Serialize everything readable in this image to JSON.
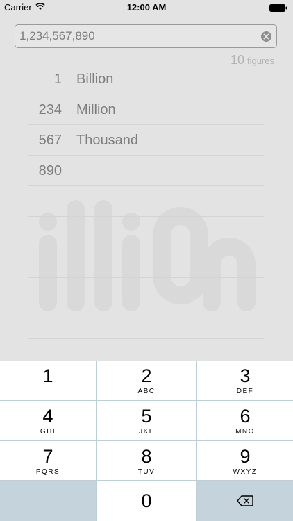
{
  "status_bar": {
    "carrier": "Carrier",
    "time": "12:00 AM"
  },
  "input": {
    "value": "1,234,567,890"
  },
  "figures": {
    "count": "10",
    "label": "figures"
  },
  "rows": [
    {
      "number": "1",
      "unit": "Billion"
    },
    {
      "number": "234",
      "unit": "Million"
    },
    {
      "number": "567",
      "unit": "Thousand"
    },
    {
      "number": "890",
      "unit": ""
    },
    {
      "number": "",
      "unit": ""
    },
    {
      "number": "",
      "unit": ""
    },
    {
      "number": "",
      "unit": ""
    },
    {
      "number": "",
      "unit": ""
    },
    {
      "number": "",
      "unit": ""
    }
  ],
  "watermark": {
    "text": "illiOn"
  },
  "keypad": {
    "keys": [
      {
        "digit": "1",
        "letters": ""
      },
      {
        "digit": "2",
        "letters": "ABC"
      },
      {
        "digit": "3",
        "letters": "DEF"
      },
      {
        "digit": "4",
        "letters": "GHI"
      },
      {
        "digit": "5",
        "letters": "JKL"
      },
      {
        "digit": "6",
        "letters": "MNO"
      },
      {
        "digit": "7",
        "letters": "PQRS"
      },
      {
        "digit": "8",
        "letters": "TUV"
      },
      {
        "digit": "9",
        "letters": "WXYZ"
      },
      {
        "digit": "0",
        "letters": ""
      }
    ],
    "delete_icon": "backspace-icon"
  },
  "colors": {
    "background": "#e3e3e3",
    "keypad_background": "#bfcfd8",
    "text_gray": "#7d7d7d"
  }
}
